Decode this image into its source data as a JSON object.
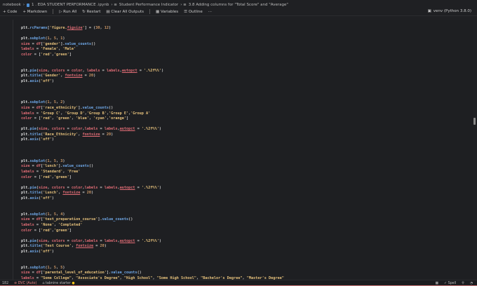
{
  "breadcrumb": [
    "notebook",
    "1 . EDA STUDENT PERFORMANCE .ipynb",
    "Student Performance Indicator",
    "3.8 Adding columns for \"Total Score\" and \"Average\""
  ],
  "toolbar": {
    "code": "+ Code",
    "markdown": "+ Markdown",
    "run_all": "▷ Run All",
    "restart": "↻ Restart",
    "clear": "▤ Clear All Outputs",
    "variables": "▦ Variables",
    "outline": "☰ Outline",
    "more": "···"
  },
  "kernel": "venv (Python 3.8.0)",
  "status": {
    "line": "182",
    "dvc": "DVC (Auto)",
    "tabnine": "tabnine starter",
    "spell": "✓ Spell"
  },
  "code_lines": [
    [
      [
        "p",
        "plt."
      ],
      [
        "f",
        "rcParams"
      ],
      [
        "o",
        "["
      ],
      [
        "s",
        "'figure."
      ],
      [
        "k",
        "figsize"
      ],
      [
        "s",
        "'"
      ],
      [
        "o",
        "] = ("
      ],
      [
        "n",
        "30"
      ],
      [
        "o",
        ", "
      ],
      [
        "n",
        "12"
      ],
      [
        "o",
        ")"
      ]
    ],
    [],
    [
      [
        "p",
        "plt."
      ],
      [
        "f",
        "subplot"
      ],
      [
        "o",
        "("
      ],
      [
        "n",
        "1"
      ],
      [
        "o",
        ", "
      ],
      [
        "n",
        "5"
      ],
      [
        "o",
        ", "
      ],
      [
        "n",
        "1"
      ],
      [
        "o",
        ")"
      ]
    ],
    [
      [
        "v",
        "size"
      ],
      [
        "o",
        " = "
      ],
      [
        "v",
        "df"
      ],
      [
        "o",
        "["
      ],
      [
        "s",
        "'gender'"
      ],
      [
        "o",
        "]."
      ],
      [
        "f",
        "value_counts"
      ],
      [
        "o",
        "()"
      ]
    ],
    [
      [
        "v",
        "labels"
      ],
      [
        "o",
        " = "
      ],
      [
        "s",
        "'Female'"
      ],
      [
        "o",
        ", "
      ],
      [
        "s",
        "'Male'"
      ]
    ],
    [
      [
        "v",
        "color"
      ],
      [
        "o",
        " = ["
      ],
      [
        "s",
        "'red'"
      ],
      [
        "o",
        ","
      ],
      [
        "s",
        "'green'"
      ],
      [
        "o",
        "]"
      ]
    ],
    [],
    [],
    [
      [
        "p",
        "plt."
      ],
      [
        "f",
        "pie"
      ],
      [
        "o",
        "("
      ],
      [
        "v",
        "size"
      ],
      [
        "o",
        ", "
      ],
      [
        "v",
        "colors"
      ],
      [
        "o",
        " = "
      ],
      [
        "v",
        "color"
      ],
      [
        "o",
        ", "
      ],
      [
        "v",
        "labels"
      ],
      [
        "o",
        " = "
      ],
      [
        "v",
        "labels"
      ],
      [
        "o",
        ","
      ],
      [
        "k",
        "autopct"
      ],
      [
        "o",
        " = "
      ],
      [
        "s",
        "'.%2f%%'"
      ],
      [
        "o",
        ")"
      ]
    ],
    [
      [
        "p",
        "plt."
      ],
      [
        "f",
        "title"
      ],
      [
        "o",
        "("
      ],
      [
        "s",
        "'Gender'"
      ],
      [
        "o",
        ", "
      ],
      [
        "k",
        "fontsize"
      ],
      [
        "o",
        " = "
      ],
      [
        "n",
        "20"
      ],
      [
        "o",
        ")"
      ]
    ],
    [
      [
        "p",
        "plt."
      ],
      [
        "f",
        "axis"
      ],
      [
        "o",
        "("
      ],
      [
        "s",
        "'off'"
      ],
      [
        "o",
        ")"
      ]
    ],
    [],
    [],
    [],
    [
      [
        "p",
        "plt."
      ],
      [
        "f",
        "subplot"
      ],
      [
        "o",
        "("
      ],
      [
        "n",
        "1"
      ],
      [
        "o",
        ", "
      ],
      [
        "n",
        "5"
      ],
      [
        "o",
        ", "
      ],
      [
        "n",
        "2"
      ],
      [
        "o",
        ")"
      ]
    ],
    [
      [
        "v",
        "size"
      ],
      [
        "o",
        " = "
      ],
      [
        "v",
        "df"
      ],
      [
        "o",
        "["
      ],
      [
        "s",
        "'race_ethnicity'"
      ],
      [
        "o",
        "]."
      ],
      [
        "f",
        "value_counts"
      ],
      [
        "o",
        "()"
      ]
    ],
    [
      [
        "v",
        "labels"
      ],
      [
        "o",
        " = "
      ],
      [
        "s",
        "'Group C'"
      ],
      [
        "o",
        ", "
      ],
      [
        "s",
        "'Group D'"
      ],
      [
        "o",
        ","
      ],
      [
        "s",
        "'Group B'"
      ],
      [
        "o",
        ","
      ],
      [
        "s",
        "'Group E'"
      ],
      [
        "o",
        ","
      ],
      [
        "s",
        "'Group A'"
      ]
    ],
    [
      [
        "v",
        "color"
      ],
      [
        "o",
        " = ["
      ],
      [
        "s",
        "'red'"
      ],
      [
        "o",
        ", "
      ],
      [
        "s",
        "'green'"
      ],
      [
        "o",
        ", "
      ],
      [
        "s",
        "'blue'"
      ],
      [
        "o",
        ", "
      ],
      [
        "s",
        "'cyan'"
      ],
      [
        "o",
        ","
      ],
      [
        "s",
        "'orange'"
      ],
      [
        "o",
        "]"
      ]
    ],
    [],
    [
      [
        "p",
        "plt."
      ],
      [
        "f",
        "pie"
      ],
      [
        "o",
        "("
      ],
      [
        "v",
        "size"
      ],
      [
        "o",
        ", "
      ],
      [
        "v",
        "colors"
      ],
      [
        "o",
        " = "
      ],
      [
        "v",
        "color"
      ],
      [
        "o",
        ","
      ],
      [
        "v",
        "labels"
      ],
      [
        "o",
        " = "
      ],
      [
        "v",
        "labels"
      ],
      [
        "o",
        ","
      ],
      [
        "k",
        "autopct"
      ],
      [
        "o",
        " = "
      ],
      [
        "s",
        "'.%2f%%'"
      ],
      [
        "o",
        ")"
      ]
    ],
    [
      [
        "p",
        "plt."
      ],
      [
        "f",
        "title"
      ],
      [
        "o",
        "("
      ],
      [
        "s",
        "'Race_Ethnicity'"
      ],
      [
        "o",
        ", "
      ],
      [
        "k",
        "fontsize"
      ],
      [
        "o",
        " = "
      ],
      [
        "n",
        "20"
      ],
      [
        "o",
        ")"
      ]
    ],
    [
      [
        "p",
        "plt."
      ],
      [
        "f",
        "axis"
      ],
      [
        "o",
        "("
      ],
      [
        "s",
        "'off'"
      ],
      [
        "o",
        ")"
      ]
    ],
    [],
    [],
    [],
    [
      [
        "p",
        "plt."
      ],
      [
        "f",
        "subplot"
      ],
      [
        "o",
        "("
      ],
      [
        "n",
        "1"
      ],
      [
        "o",
        ", "
      ],
      [
        "n",
        "5"
      ],
      [
        "o",
        ", "
      ],
      [
        "n",
        "3"
      ],
      [
        "o",
        ")"
      ]
    ],
    [
      [
        "v",
        "size"
      ],
      [
        "o",
        " = "
      ],
      [
        "v",
        "df"
      ],
      [
        "o",
        "["
      ],
      [
        "s",
        "'lunch'"
      ],
      [
        "o",
        "]."
      ],
      [
        "f",
        "value_counts"
      ],
      [
        "o",
        "()"
      ]
    ],
    [
      [
        "v",
        "labels"
      ],
      [
        "o",
        " = "
      ],
      [
        "s",
        "'Standard'"
      ],
      [
        "o",
        ", "
      ],
      [
        "s",
        "'Free'"
      ]
    ],
    [
      [
        "v",
        "color"
      ],
      [
        "o",
        " = ["
      ],
      [
        "s",
        "'red'"
      ],
      [
        "o",
        ","
      ],
      [
        "s",
        "'green'"
      ],
      [
        "o",
        "]"
      ]
    ],
    [],
    [
      [
        "p",
        "plt."
      ],
      [
        "f",
        "pie"
      ],
      [
        "o",
        "("
      ],
      [
        "v",
        "size"
      ],
      [
        "o",
        ", "
      ],
      [
        "v",
        "colors"
      ],
      [
        "o",
        " = "
      ],
      [
        "v",
        "color"
      ],
      [
        "o",
        ","
      ],
      [
        "v",
        "labels"
      ],
      [
        "o",
        " = "
      ],
      [
        "v",
        "labels"
      ],
      [
        "o",
        ","
      ],
      [
        "k",
        "autopct"
      ],
      [
        "o",
        " = "
      ],
      [
        "s",
        "'.%2f%%'"
      ],
      [
        "o",
        ")"
      ]
    ],
    [
      [
        "p",
        "plt."
      ],
      [
        "f",
        "title"
      ],
      [
        "o",
        "("
      ],
      [
        "s",
        "'Lunch'"
      ],
      [
        "o",
        ", "
      ],
      [
        "k",
        "fontsize"
      ],
      [
        "o",
        " = "
      ],
      [
        "n",
        "20"
      ],
      [
        "o",
        ")"
      ]
    ],
    [
      [
        "p",
        "plt."
      ],
      [
        "f",
        "axis"
      ],
      [
        "o",
        "("
      ],
      [
        "s",
        "'off'"
      ],
      [
        "o",
        ")"
      ]
    ],
    [],
    [],
    [
      [
        "p",
        "plt."
      ],
      [
        "f",
        "subplot"
      ],
      [
        "o",
        "("
      ],
      [
        "n",
        "1"
      ],
      [
        "o",
        ", "
      ],
      [
        "n",
        "5"
      ],
      [
        "o",
        ", "
      ],
      [
        "n",
        "4"
      ],
      [
        "o",
        ")"
      ]
    ],
    [
      [
        "v",
        "size"
      ],
      [
        "o",
        " = "
      ],
      [
        "v",
        "df"
      ],
      [
        "o",
        "["
      ],
      [
        "s",
        "'test_preparation_course'"
      ],
      [
        "o",
        "]."
      ],
      [
        "f",
        "value_counts"
      ],
      [
        "o",
        "()"
      ]
    ],
    [
      [
        "v",
        "labels"
      ],
      [
        "o",
        " = "
      ],
      [
        "s",
        "'None'"
      ],
      [
        "o",
        ", "
      ],
      [
        "s",
        "'Completed'"
      ]
    ],
    [
      [
        "v",
        "color"
      ],
      [
        "o",
        " = ["
      ],
      [
        "s",
        "'red'"
      ],
      [
        "o",
        ","
      ],
      [
        "s",
        "'green'"
      ],
      [
        "o",
        "]"
      ]
    ],
    [],
    [
      [
        "p",
        "plt."
      ],
      [
        "f",
        "pie"
      ],
      [
        "o",
        "("
      ],
      [
        "v",
        "size"
      ],
      [
        "o",
        ", "
      ],
      [
        "v",
        "colors"
      ],
      [
        "o",
        " = "
      ],
      [
        "v",
        "color"
      ],
      [
        "o",
        ","
      ],
      [
        "v",
        "labels"
      ],
      [
        "o",
        " = "
      ],
      [
        "v",
        "labels"
      ],
      [
        "o",
        ","
      ],
      [
        "k",
        "autopct"
      ],
      [
        "o",
        " = "
      ],
      [
        "s",
        "'.%2f%%'"
      ],
      [
        "o",
        ")"
      ]
    ],
    [
      [
        "p",
        "plt."
      ],
      [
        "f",
        "title"
      ],
      [
        "o",
        "("
      ],
      [
        "s",
        "'Test Course'"
      ],
      [
        "o",
        ", "
      ],
      [
        "k",
        "fontsize"
      ],
      [
        "o",
        " = "
      ],
      [
        "n",
        "20"
      ],
      [
        "o",
        ")"
      ]
    ],
    [
      [
        "p",
        "plt."
      ],
      [
        "f",
        "axis"
      ],
      [
        "o",
        "("
      ],
      [
        "s",
        "'off'"
      ],
      [
        "o",
        ")"
      ]
    ],
    [],
    [],
    [
      [
        "p",
        "plt."
      ],
      [
        "f",
        "subplot"
      ],
      [
        "o",
        "("
      ],
      [
        "n",
        "1"
      ],
      [
        "o",
        ", "
      ],
      [
        "n",
        "5"
      ],
      [
        "o",
        ", "
      ],
      [
        "n",
        "5"
      ],
      [
        "o",
        ")"
      ]
    ],
    [
      [
        "v",
        "size"
      ],
      [
        "o",
        " = "
      ],
      [
        "v",
        "df"
      ],
      [
        "o",
        "["
      ],
      [
        "s",
        "'parental_level_of_education'"
      ],
      [
        "o",
        "]."
      ],
      [
        "f",
        "value_counts"
      ],
      [
        "o",
        "()"
      ]
    ],
    [
      [
        "v",
        "labels"
      ],
      [
        "o",
        " = "
      ],
      [
        "s",
        "\"Some College\""
      ],
      [
        "o",
        ", "
      ],
      [
        "s",
        "\"Associate's Degree\""
      ],
      [
        "o",
        ", "
      ],
      [
        "s",
        "\"High School\""
      ],
      [
        "o",
        ", "
      ],
      [
        "s",
        "\"Some High School\""
      ],
      [
        "o",
        ", "
      ],
      [
        "s",
        "\"Bachelor's Degree\""
      ],
      [
        "o",
        ", "
      ],
      [
        "s",
        "\"Master's Degree\""
      ]
    ]
  ]
}
